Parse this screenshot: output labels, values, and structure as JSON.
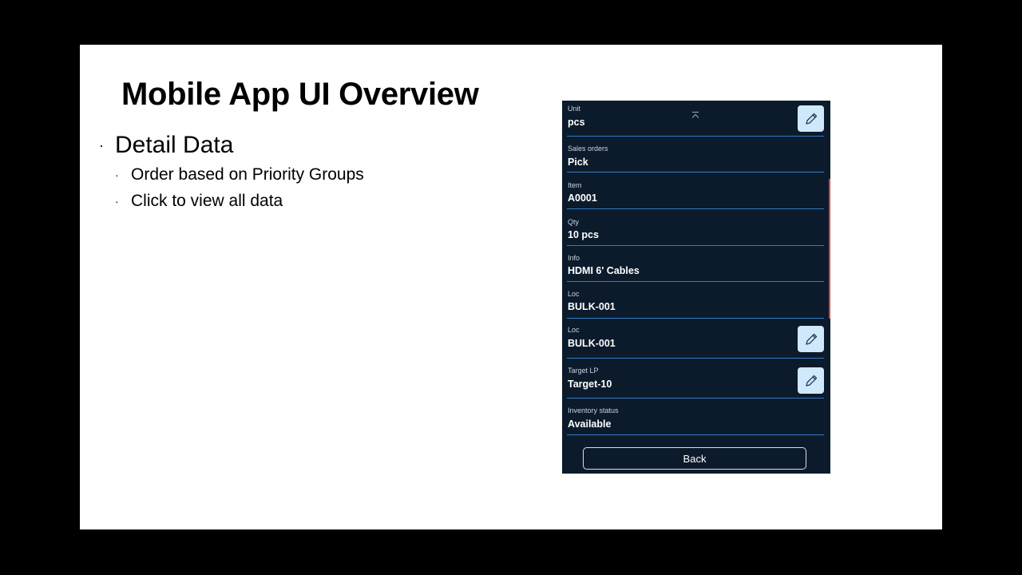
{
  "slide": {
    "title": "Mobile App UI Overview",
    "bullet_main": "Detail Data",
    "sub_bullets": [
      "Order based on Priority Groups",
      "Click to view all data"
    ]
  },
  "phone": {
    "fields": [
      {
        "label": "Unit",
        "value": "pcs",
        "editable": true
      },
      {
        "label": "Sales orders",
        "value": "Pick",
        "editable": false
      },
      {
        "label": "Item",
        "value": "A0001",
        "editable": false
      },
      {
        "label": "Qty",
        "value": "10 pcs",
        "editable": false
      },
      {
        "label": "Info",
        "value": "HDMI 6' Cables",
        "editable": false
      },
      {
        "label": "Loc",
        "value": "BULK-001",
        "editable": false
      },
      {
        "label": "Loc",
        "value": "BULK-001",
        "editable": true
      },
      {
        "label": "Target LP",
        "value": "Target-10",
        "editable": true
      },
      {
        "label": "Inventory status",
        "value": "Available",
        "editable": false
      }
    ],
    "back_label": "Back",
    "icons": {
      "edit": "pencil-icon",
      "collapse": "collapse-up-icon"
    },
    "colors": {
      "background": "#0c1b2b",
      "divider": "#2f7bc4",
      "edit_button": "#cfe8fb",
      "scroll_indicator": "#d04848"
    }
  }
}
